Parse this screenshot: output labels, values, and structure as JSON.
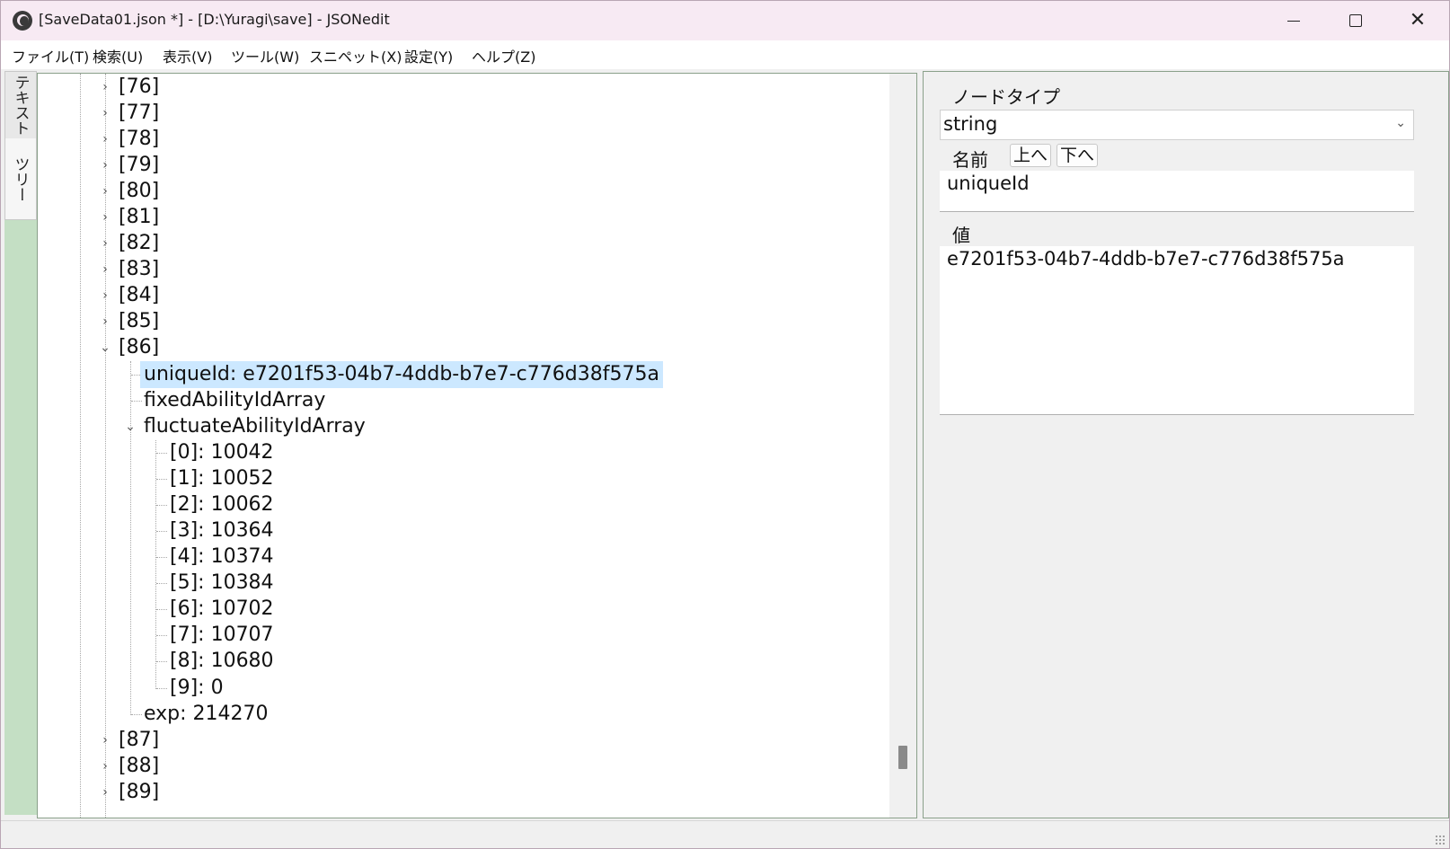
{
  "window": {
    "title": "[SaveData01.json *] - [D:\\Yuragi\\save] - JSONedit",
    "close_glyph": "✕"
  },
  "menu": [
    {
      "label": "ファイル(T)"
    },
    {
      "label": "検索(U)"
    },
    {
      "label": "表示(V)"
    },
    {
      "label": "ツール(W)"
    },
    {
      "label": "スニペット(X)"
    },
    {
      "label": "設定(Y)"
    },
    {
      "label": "ヘルプ(Z)"
    }
  ],
  "side_tabs": {
    "text": "テキスト",
    "tree": "ツリー"
  },
  "tree": {
    "top_rows": [
      "[76]",
      "[77]",
      "[78]",
      "[79]",
      "[80]",
      "[81]",
      "[82]",
      "[83]",
      "[84]",
      "[85]"
    ],
    "expanded_label": "[86]",
    "children": {
      "selected": "uniqueId: e7201f53-04b7-4ddb-b7e7-c776d38f575a",
      "fixed": "fixedAbilityIdArray",
      "fluctuate": "fluctuateAbilityIdArray",
      "exp": "exp: 214270"
    },
    "fluctuate_items": [
      "[0]: 10042",
      "[1]: 10052",
      "[2]: 10062",
      "[3]: 10364",
      "[4]: 10374",
      "[5]: 10384",
      "[6]: 10702",
      "[7]: 10707",
      "[8]: 10680",
      "[9]: 0"
    ],
    "bottom_rows": [
      "[87]",
      "[88]",
      "[89]"
    ]
  },
  "inspector": {
    "node_type_label": "ノードタイプ",
    "node_type_value": "string",
    "name_label": "名前",
    "up_button": "上へ",
    "down_button": "下へ",
    "name_value": "uniqueId",
    "value_label": "値",
    "value_text": "e7201f53-04b7-4ddb-b7e7-c776d38f575a"
  },
  "icons": {
    "app": "app-icon",
    "expand": "chevron-right-icon",
    "collapse": "chevron-down-icon"
  },
  "colors": {
    "selection": "#cce8ff",
    "side_tab_bg": "#c4dfc4",
    "title_bar": "#f7eaf3"
  }
}
